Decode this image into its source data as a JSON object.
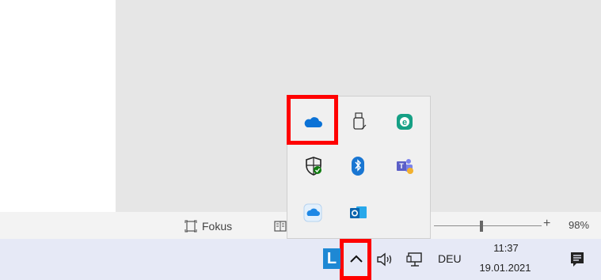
{
  "status_bar": {
    "focus_label": "Fokus",
    "zoom_plus": "+",
    "zoom_percent": "98%",
    "zoom_level_percent": 98
  },
  "tray_overflow": {
    "icons": [
      {
        "name": "onedrive-icon",
        "color": "#0b72d6"
      },
      {
        "name": "usb-drive-icon",
        "color": "#333333"
      },
      {
        "name": "eset-icon",
        "color": "#16a085"
      },
      {
        "name": "windows-security-icon",
        "color": "#107c10"
      },
      {
        "name": "bluetooth-icon",
        "color": "#1976d2"
      },
      {
        "name": "teams-icon",
        "color": "#5b5fc7"
      },
      {
        "name": "onedrive-alt-icon",
        "color": "#1e88e5"
      },
      {
        "name": "outlook-icon",
        "color": "#0a64ad"
      }
    ]
  },
  "taskbar": {
    "app_letter": "L",
    "language": "DEU",
    "time": "11:37",
    "date": "19.01.2021"
  },
  "highlight_color": "#ff0000"
}
